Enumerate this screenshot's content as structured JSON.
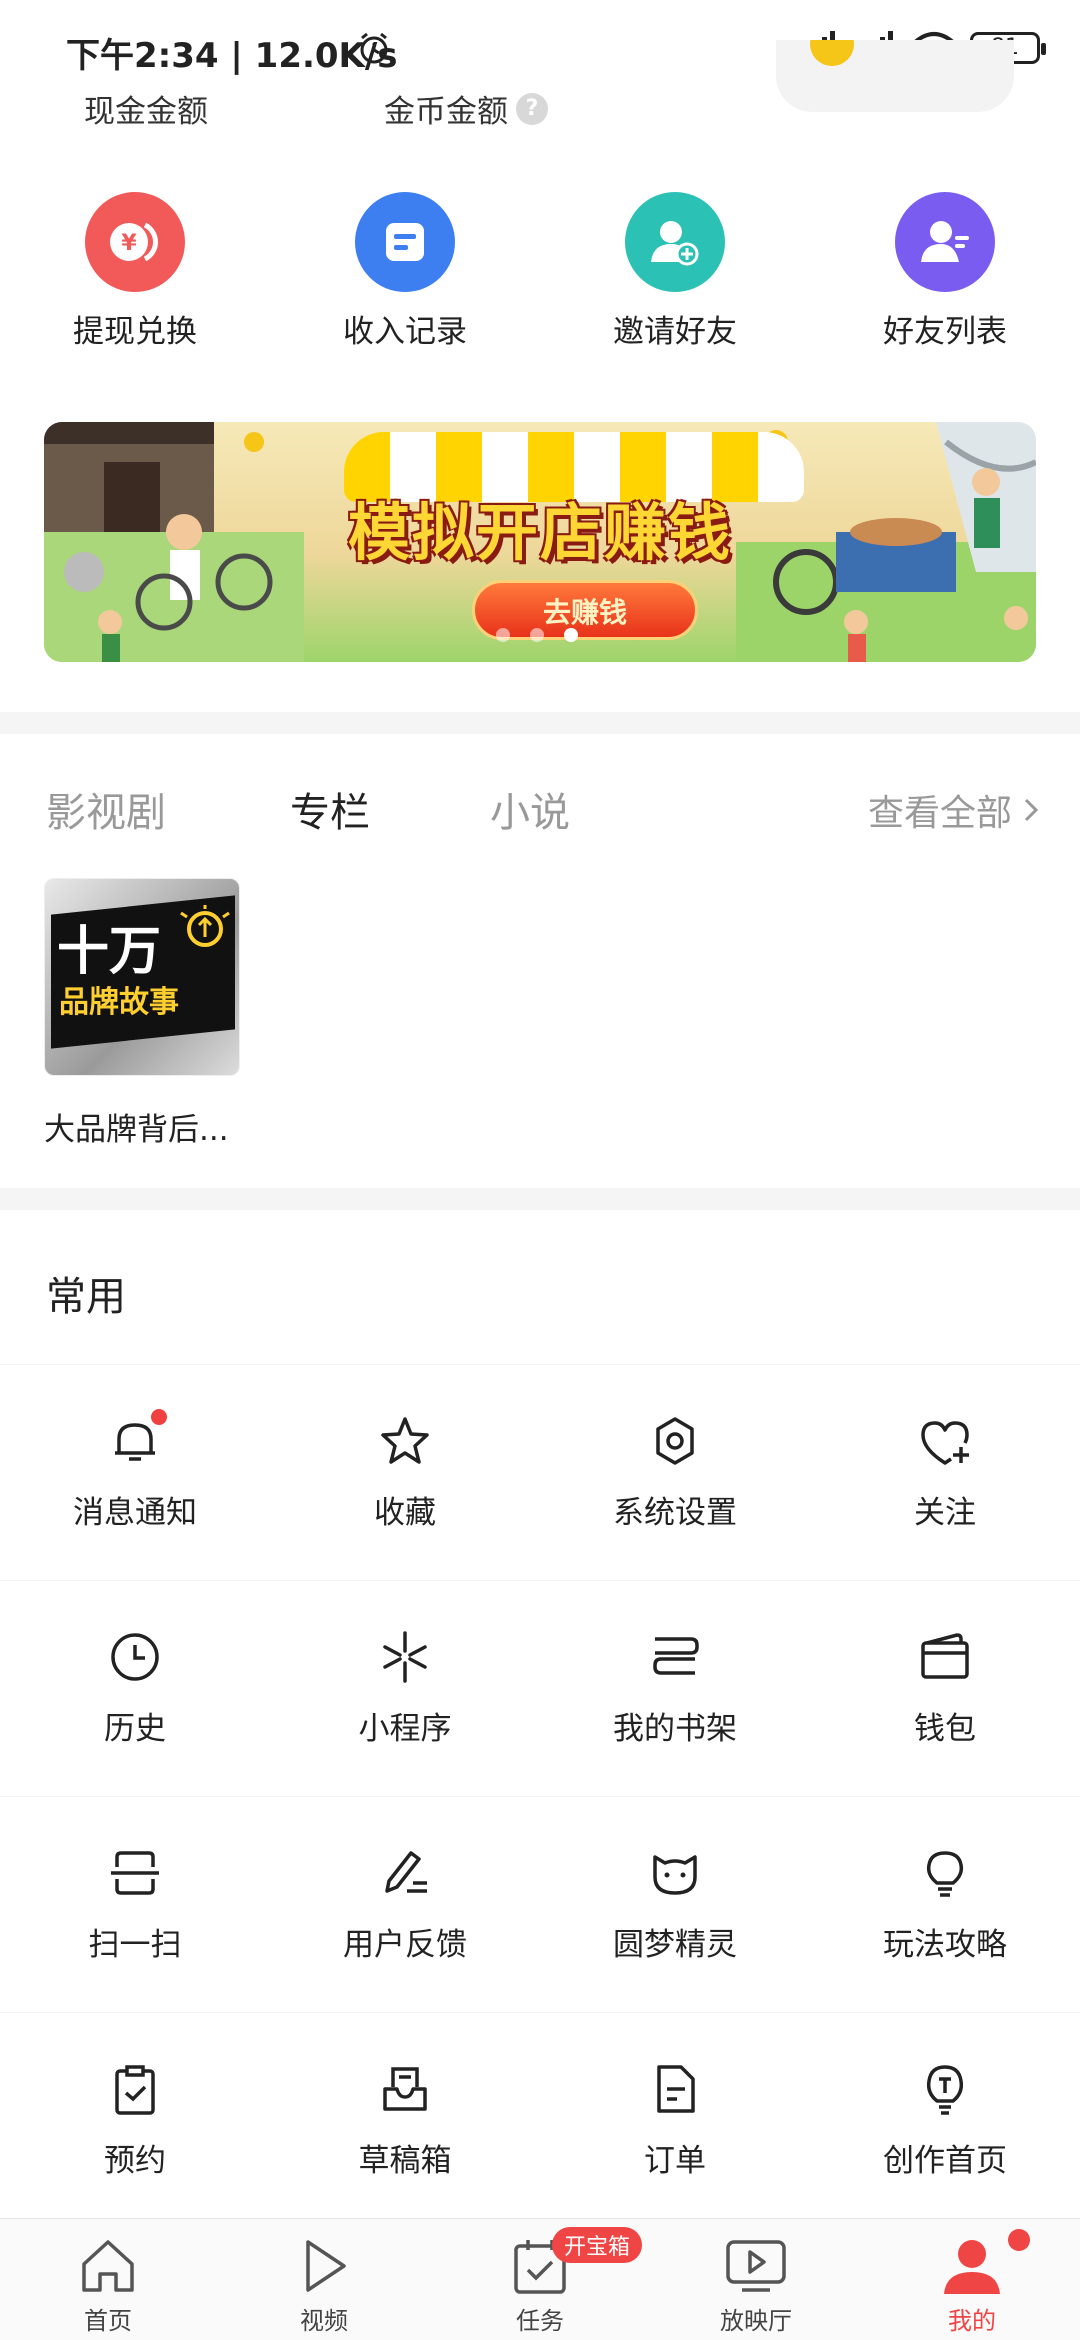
{
  "status_bar": {
    "time": "下午2:34 | 12.0K/s",
    "battery": "81"
  },
  "amounts": {
    "cash_label": "现金金额",
    "coin_label": "金币金额",
    "help": "?"
  },
  "actions": [
    {
      "label": "提现兑换",
      "color": "#f25a5a",
      "icon": "yen-exchange-icon"
    },
    {
      "label": "收入记录",
      "color": "#3d7ff0",
      "icon": "record-icon"
    },
    {
      "label": "邀请好友",
      "color": "#2cc1b5",
      "icon": "invite-friend-icon"
    },
    {
      "label": "好友列表",
      "color": "#7a5cf0",
      "icon": "friend-list-icon"
    }
  ],
  "banner": {
    "title": "模拟开店赚钱",
    "button": "去赚钱",
    "dots_count": 3,
    "active_dot": 3
  },
  "content_tabs": {
    "tabs": [
      "影视剧",
      "专栏",
      "小说"
    ],
    "active": "专栏",
    "see_all": "查看全部"
  },
  "column_card": {
    "thumb_big": "十万",
    "thumb_small": "品牌故事",
    "title": "大品牌背后..."
  },
  "common": {
    "title": "常用",
    "items": [
      {
        "label": "消息通知",
        "icon": "bell-icon",
        "dot": true
      },
      {
        "label": "收藏",
        "icon": "star-icon"
      },
      {
        "label": "系统设置",
        "icon": "gear-icon"
      },
      {
        "label": "关注",
        "icon": "heart-plus-icon"
      },
      {
        "label": "历史",
        "icon": "clock-icon"
      },
      {
        "label": "小程序",
        "icon": "mini-program-icon"
      },
      {
        "label": "我的书架",
        "icon": "bookshelf-icon"
      },
      {
        "label": "钱包",
        "icon": "wallet-icon"
      },
      {
        "label": "扫一扫",
        "icon": "scan-icon"
      },
      {
        "label": "用户反馈",
        "icon": "feedback-pen-icon"
      },
      {
        "label": "圆梦精灵",
        "icon": "cat-face-icon"
      },
      {
        "label": "玩法攻略",
        "icon": "lightbulb-icon"
      },
      {
        "label": "预约",
        "icon": "clipboard-check-icon"
      },
      {
        "label": "草稿箱",
        "icon": "inbox-icon"
      },
      {
        "label": "订单",
        "icon": "order-doc-icon"
      },
      {
        "label": "创作首页",
        "icon": "creator-bulb-icon"
      }
    ]
  },
  "bottom_nav": {
    "items": [
      {
        "label": "首页",
        "icon": "home-icon"
      },
      {
        "label": "视频",
        "icon": "play-icon"
      },
      {
        "label": "任务",
        "icon": "task-icon",
        "badge": "开宝箱"
      },
      {
        "label": "放映厅",
        "icon": "theater-icon"
      },
      {
        "label": "我的",
        "icon": "profile-icon",
        "active": true,
        "dot": true
      }
    ]
  },
  "colors": {
    "accent_red": "#f04545",
    "text_dark": "#222222",
    "text_gray": "#999999"
  }
}
